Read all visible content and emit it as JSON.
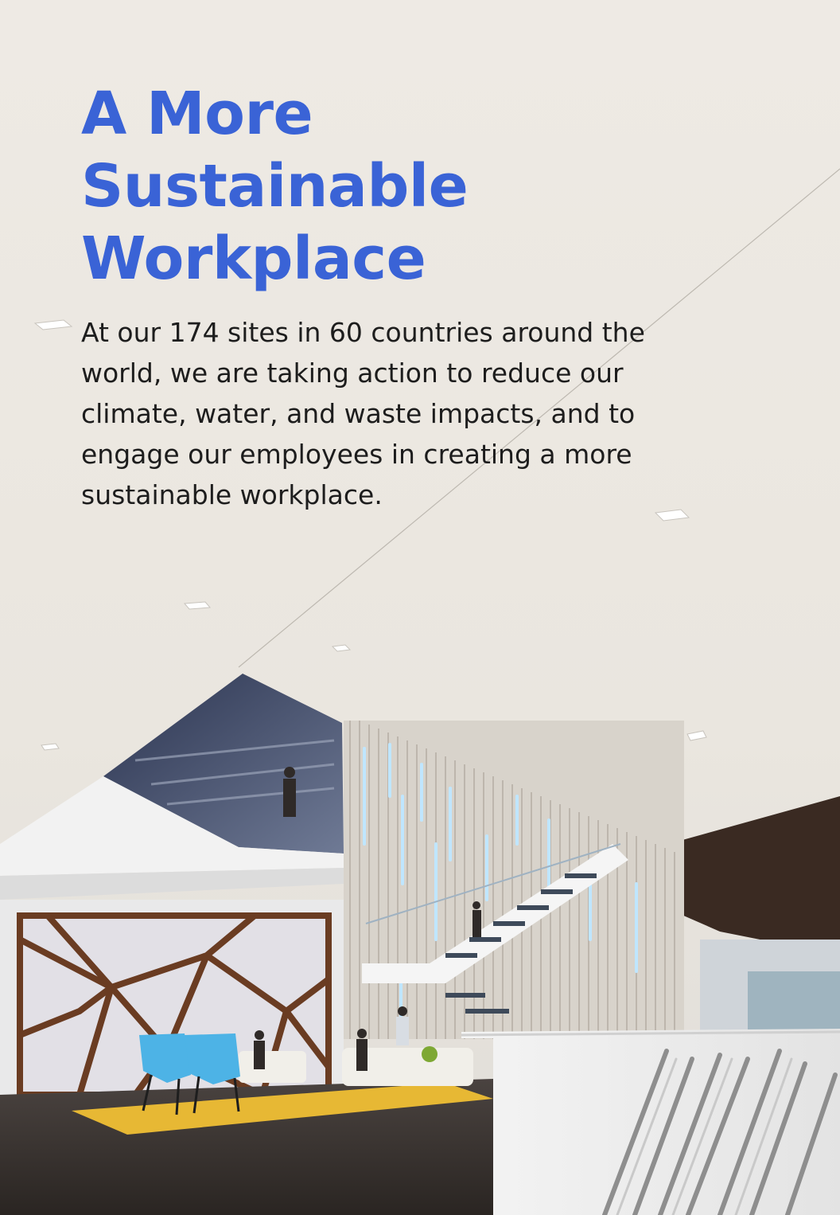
{
  "headline": {
    "line1": "A More",
    "line2": "Sustainable",
    "line3": "Workplace"
  },
  "body": {
    "text": "At our 174 sites in 60 countries around the world, we are taking action to reduce our climate, water, and waste impacts, and to engage our employees in creating a more sustainable workplace."
  },
  "colors": {
    "headline": "#3a63d6",
    "body_text": "#1d1d1d",
    "ceiling": "#efebe5"
  },
  "image": {
    "subject": "office-atrium-photo"
  }
}
